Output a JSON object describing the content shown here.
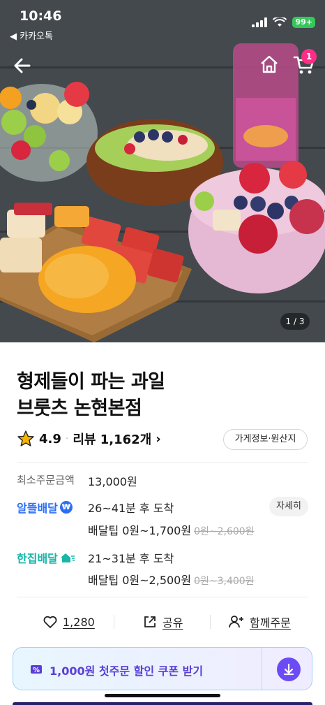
{
  "status_bar": {
    "time": "10:46",
    "back_app": "◀ 카카오톡",
    "battery": "99+"
  },
  "header": {
    "cart_count": "1",
    "photo_counter": "1 / 3"
  },
  "store": {
    "name_line1": "형제들이 파는 과일",
    "name_line2": "브룻츠 논현본점",
    "rating": "4.9",
    "review_label": "리뷰 1,162개",
    "info_button": "가게정보·원산지"
  },
  "order": {
    "min_label": "최소주문금액",
    "min_value": "13,000원"
  },
  "delivery": {
    "economy": {
      "label": "알뜰배달",
      "eta": "26~41분 후 도착",
      "tip": "배달팁 0원~1,700원",
      "tip_original": "0원~2,600원",
      "detail_button": "자세히"
    },
    "single": {
      "label": "한집배달",
      "eta": "21~31분 후 도착",
      "tip": "배달팁 0원~2,500원",
      "tip_original": "0원~3,400원"
    }
  },
  "actions": {
    "like_count": "1,280",
    "share": "공유",
    "group_order": "함께주문"
  },
  "coupon": {
    "text": "1,000원 첫주문 할인 쿠폰 받기"
  },
  "colors": {
    "economy_blue": "#2b6ef5",
    "single_teal": "#16b6a8",
    "coupon_purple": "#6c4bf5",
    "cart_badge": "#ff2d87"
  }
}
